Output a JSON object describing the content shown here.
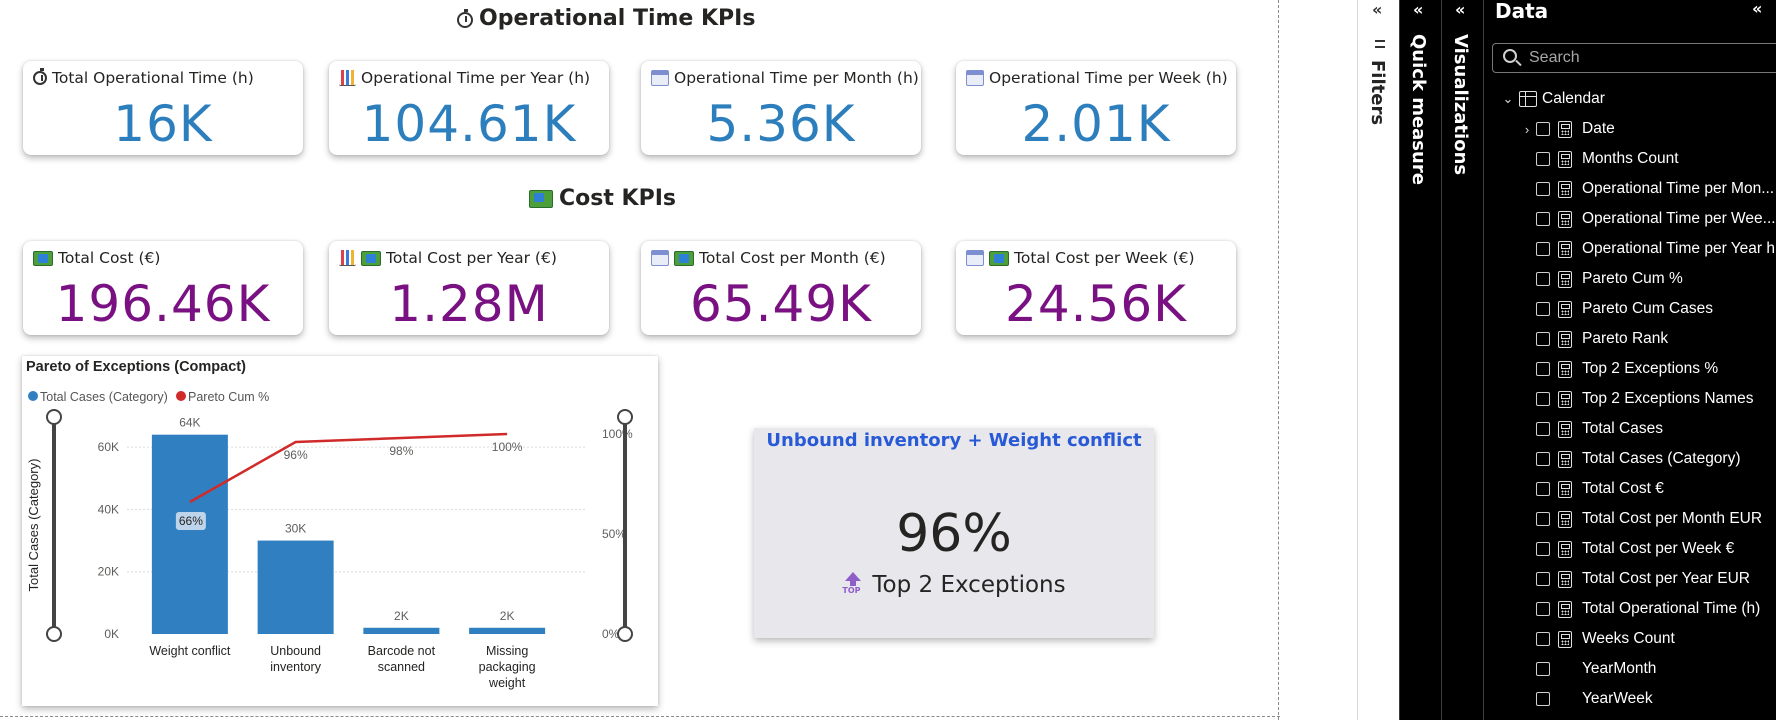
{
  "report": {
    "op_section_title": "Operational Time KPIs",
    "cost_section_title": "Cost KPIs",
    "op_cards": [
      {
        "label": "Total Operational Time (h)",
        "value": "16K",
        "icon": "timer-icon"
      },
      {
        "label": "Operational Time per Year (h)",
        "value": "104.61K",
        "icon": "bar-chart-icon"
      },
      {
        "label": "Operational Time per Month (h)",
        "value": "5.36K",
        "icon": "calendar-icon"
      },
      {
        "label": "Operational Time per Week (h)",
        "value": "2.01K",
        "icon": "calendar-icon"
      }
    ],
    "cost_cards": [
      {
        "label": "Total Cost (€)",
        "value": "196.46K",
        "icon": "money-icon"
      },
      {
        "label": "Total Cost per Year (€)",
        "value": "1.28M",
        "icon": "bar-chart-icon"
      },
      {
        "label": "Total Cost per Month (€)",
        "value": "65.49K",
        "icon": "calendar-icon"
      },
      {
        "label": "Total Cost per Week (€)",
        "value": "24.56K",
        "icon": "calendar-icon"
      }
    ],
    "colors": {
      "kpi_blue": "#2c7fbc",
      "kpi_purple": "#7a1182",
      "bar": "#2f7fc1",
      "line": "#d02a2a",
      "top2_title": "#2859d6"
    },
    "top2": {
      "title": "Unbound inventory + Weight conflict",
      "value": "96%",
      "label": "Top 2 Exceptions",
      "icon": "top-arrow-icon"
    }
  },
  "chart_data": {
    "type": "bar",
    "title": "Pareto of Exceptions (Compact)",
    "legend": [
      "Total Cases (Category)",
      "Pareto Cum %"
    ],
    "legend_position": "top-left",
    "categories": [
      [
        "Weight conflict"
      ],
      [
        "Unbound",
        "inventory"
      ],
      [
        "Barcode not",
        "scanned"
      ],
      [
        "Missing",
        "packaging",
        "weight"
      ]
    ],
    "series": [
      {
        "name": "Total Cases (Category)",
        "type": "bar",
        "axis": "left",
        "values": [
          64000,
          30000,
          2000,
          2000
        ],
        "labels": [
          "64K",
          "30K",
          "2K",
          "2K"
        ]
      },
      {
        "name": "Pareto Cum %",
        "type": "line",
        "axis": "right",
        "values": [
          66,
          96,
          98,
          100
        ],
        "labels": [
          "66%",
          "96%",
          "98%",
          "100%"
        ]
      }
    ],
    "ylabel": "Total Cases (Category)",
    "y2label": "Pareto Cum %",
    "ylim": [
      0,
      70000
    ],
    "y2lim": [
      0,
      109
    ],
    "yticks": [
      0,
      20000,
      40000,
      60000
    ],
    "yticklabels": [
      "0K",
      "20K",
      "40K",
      "60K"
    ],
    "y2ticks": [
      0,
      50,
      100
    ],
    "y2ticklabels": [
      "0%",
      "50%",
      "100%"
    ],
    "grid": true
  },
  "panes": {
    "filters": {
      "title": "Filters"
    },
    "quick_measure": {
      "title": "Quick measure"
    },
    "visualizations": {
      "title": "Visualizations"
    },
    "data": {
      "title": "Data",
      "search_placeholder": "Search",
      "table": "Calendar",
      "fields": [
        {
          "name": "Date",
          "type": "table",
          "expand": true
        },
        {
          "name": "Months Count",
          "type": "measure"
        },
        {
          "name": "Operational Time per Mon...",
          "type": "measure"
        },
        {
          "name": "Operational Time per Wee...",
          "type": "measure"
        },
        {
          "name": "Operational Time per Year h",
          "type": "measure"
        },
        {
          "name": "Pareto Cum %",
          "type": "measure"
        },
        {
          "name": "Pareto Cum Cases",
          "type": "measure"
        },
        {
          "name": "Pareto Rank",
          "type": "measure"
        },
        {
          "name": "Top 2 Exceptions %",
          "type": "measure"
        },
        {
          "name": "Top 2 Exceptions Names",
          "type": "measure"
        },
        {
          "name": "Total Cases",
          "type": "measure"
        },
        {
          "name": "Total Cases (Category)",
          "type": "measure"
        },
        {
          "name": "Total Cost €",
          "type": "measure"
        },
        {
          "name": "Total Cost per Month EUR",
          "type": "measure"
        },
        {
          "name": "Total Cost per Week €",
          "type": "measure"
        },
        {
          "name": "Total Cost per Year EUR",
          "type": "measure"
        },
        {
          "name": "Total Operational Time (h)",
          "type": "measure"
        },
        {
          "name": "Weeks Count",
          "type": "measure"
        },
        {
          "name": "YearMonth",
          "type": "column"
        },
        {
          "name": "YearWeek",
          "type": "column"
        }
      ]
    }
  }
}
